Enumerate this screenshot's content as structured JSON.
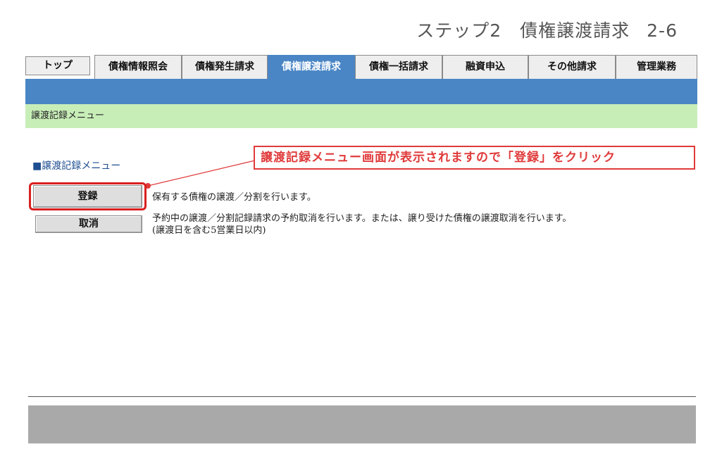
{
  "step": {
    "label": "ステップ2　債権譲渡請求",
    "number": "2-6"
  },
  "tabs": [
    {
      "label": "トップ",
      "active": false
    },
    {
      "label": "債権情報照会",
      "active": false
    },
    {
      "label": "債権発生請求",
      "active": false
    },
    {
      "label": "債権譲渡請求",
      "active": true
    },
    {
      "label": "債権一括請求",
      "active": false
    },
    {
      "label": "融資申込",
      "active": false
    },
    {
      "label": "その他請求",
      "active": false
    },
    {
      "label": "管理業務",
      "active": false
    }
  ],
  "breadcrumb": "譲渡記録メニュー",
  "section_title": "■譲渡記録メニュー",
  "callout": "譲渡記録メニュー画面が表示されますので「登録」をクリック",
  "menu": [
    {
      "button": "登録",
      "description": [
        "保有する債権の譲渡／分割を行います。"
      ]
    },
    {
      "button": "取消",
      "description": [
        "予約中の譲渡／分割記録請求の予約取消を行います。または、譲り受けた債権の譲渡取消を行います。",
        "(譲渡日を含む5営業日以内)"
      ]
    }
  ],
  "colors": {
    "tab_active": "#4a86c5",
    "header_bar": "#4a86c5",
    "breadcrumb_bar": "#c8eeb8",
    "callout": "#e03a3a",
    "footer": "#a9a9a9"
  }
}
